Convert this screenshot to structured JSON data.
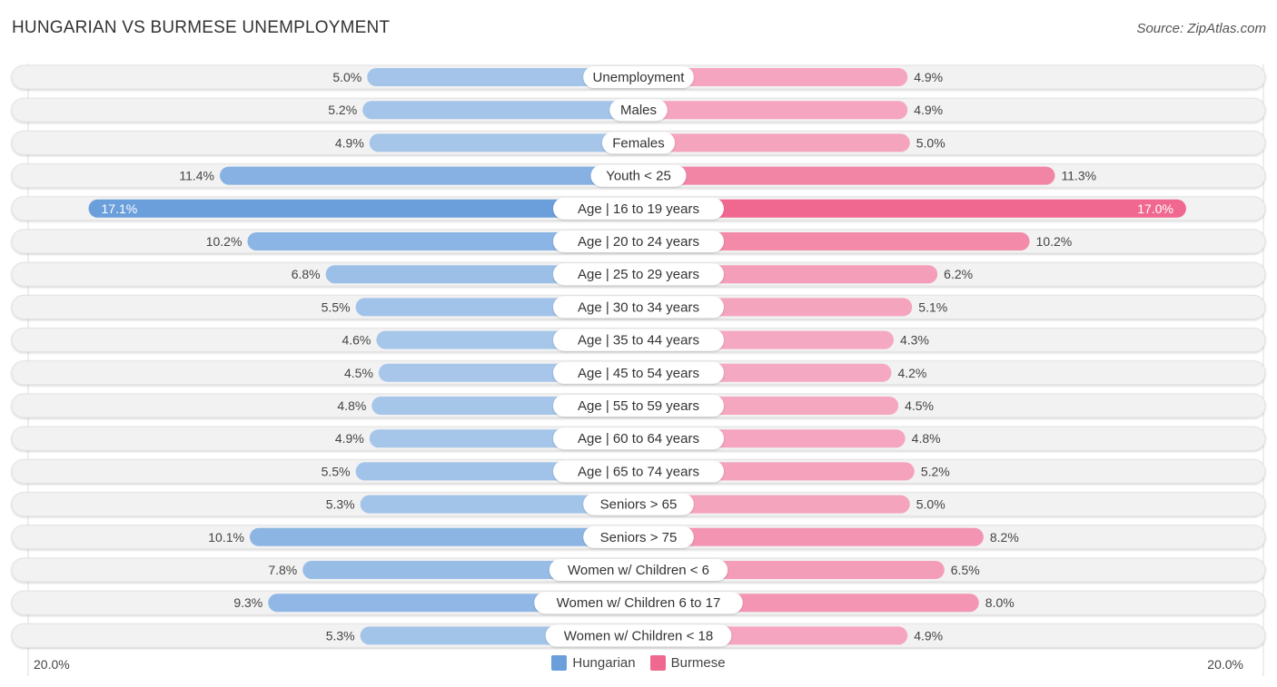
{
  "header": {
    "title": "HUNGARIAN VS BURMESE UNEMPLOYMENT",
    "source": "Source: ZipAtlas.com"
  },
  "colors": {
    "hungarian": "#6a9fdc",
    "hungarian_light": "#a8c7ea",
    "burmese": "#f06890",
    "burmese_light": "#f5a8c1",
    "row_bg": "#f2f2f2"
  },
  "chart_data": {
    "type": "bar",
    "orientation": "horizontal-diverging",
    "title": "HUNGARIAN VS BURMESE UNEMPLOYMENT",
    "xlim": [
      -20,
      20
    ],
    "axis_left_label": "20.0%",
    "axis_right_label": "20.0%",
    "legend_position": "bottom",
    "categories": [
      "Unemployment",
      "Males",
      "Females",
      "Youth < 25",
      "Age | 16 to 19 years",
      "Age | 20 to 24 years",
      "Age | 25 to 29 years",
      "Age | 30 to 34 years",
      "Age | 35 to 44 years",
      "Age | 45 to 54 years",
      "Age | 55 to 59 years",
      "Age | 60 to 64 years",
      "Age | 65 to 74 years",
      "Seniors > 65",
      "Seniors > 75",
      "Women w/ Children < 6",
      "Women w/ Children 6 to 17",
      "Women w/ Children < 18"
    ],
    "series": [
      {
        "name": "Hungarian",
        "values": [
          5.0,
          5.2,
          4.9,
          11.4,
          17.1,
          10.2,
          6.8,
          5.5,
          4.6,
          4.5,
          4.8,
          4.9,
          5.5,
          5.3,
          10.1,
          7.8,
          9.3,
          5.3
        ],
        "labels": [
          "5.0%",
          "5.2%",
          "4.9%",
          "11.4%",
          "17.1%",
          "10.2%",
          "6.8%",
          "5.5%",
          "4.6%",
          "4.5%",
          "4.8%",
          "4.9%",
          "5.5%",
          "5.3%",
          "10.1%",
          "7.8%",
          "9.3%",
          "5.3%"
        ]
      },
      {
        "name": "Burmese",
        "values": [
          4.9,
          4.9,
          5.0,
          11.3,
          17.0,
          10.2,
          6.2,
          5.1,
          4.3,
          4.2,
          4.5,
          4.8,
          5.2,
          5.0,
          8.2,
          6.5,
          8.0,
          4.9
        ],
        "labels": [
          "4.9%",
          "4.9%",
          "5.0%",
          "11.3%",
          "17.0%",
          "10.2%",
          "6.2%",
          "5.1%",
          "4.3%",
          "4.2%",
          "4.5%",
          "4.8%",
          "5.2%",
          "5.0%",
          "8.2%",
          "6.5%",
          "8.0%",
          "4.9%"
        ]
      }
    ]
  },
  "legend": {
    "items": [
      {
        "label": "Hungarian",
        "color": "#6a9fdc"
      },
      {
        "label": "Burmese",
        "color": "#f06890"
      }
    ]
  }
}
